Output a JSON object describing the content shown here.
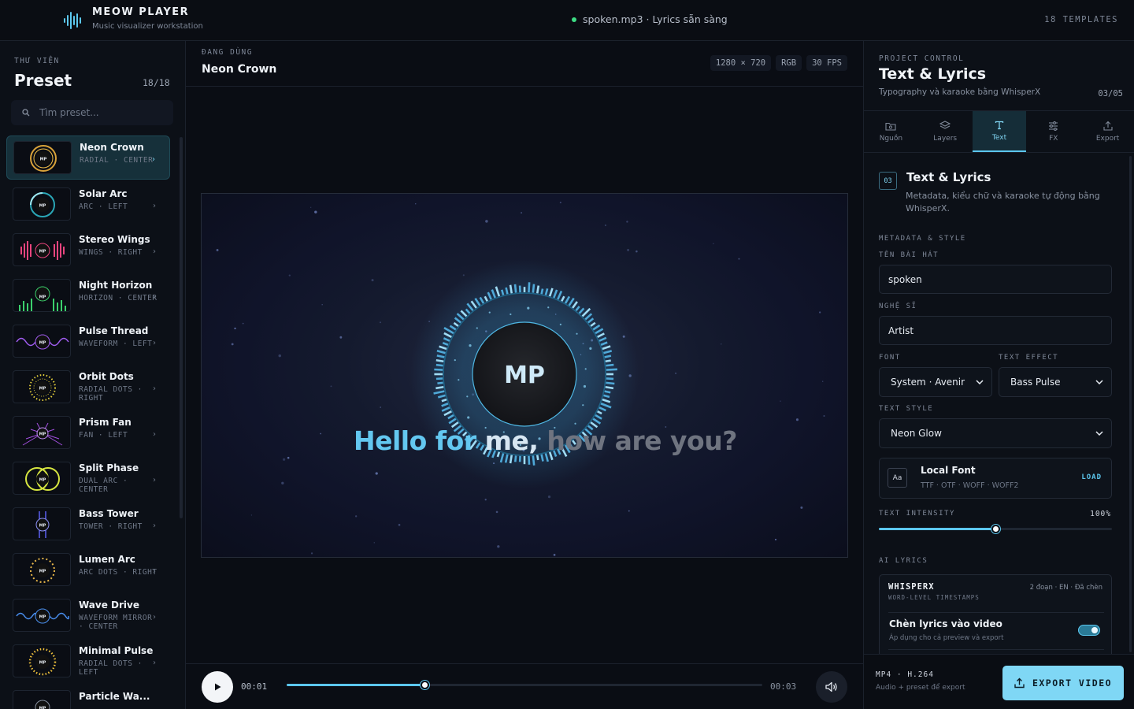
{
  "topbar": {
    "app_title": "MEOW PLAYER",
    "app_subtitle": "Music visualizer workstation",
    "status_text": "spoken.mp3 · Lyrics sẵn sàng",
    "templates": "18 TEMPLATES",
    "status_color": "#3ddc84"
  },
  "sidebar": {
    "caption": "THƯ VIỆN",
    "title": "Preset",
    "count": "18/18",
    "search_placeholder": "Tìm preset...",
    "items": [
      {
        "name": "Neon Crown",
        "tags": "RADIAL · CENTER",
        "active": true,
        "thumb": "neon-crown-thumb"
      },
      {
        "name": "Solar Arc",
        "tags": "ARC · LEFT",
        "thumb": "solar-arc-thumb"
      },
      {
        "name": "Stereo Wings",
        "tags": "WINGS · RIGHT",
        "thumb": "stereo-wings-thumb"
      },
      {
        "name": "Night Horizon",
        "tags": "HORIZON · CENTER",
        "thumb": "night-horizon-thumb"
      },
      {
        "name": "Pulse Thread",
        "tags": "WAVEFORM · LEFT",
        "thumb": "pulse-thread-thumb"
      },
      {
        "name": "Orbit Dots",
        "tags": "RADIAL DOTS · RIGHT",
        "thumb": "orbit-dots-thumb"
      },
      {
        "name": "Prism Fan",
        "tags": "FAN · LEFT",
        "thumb": "prism-fan-thumb"
      },
      {
        "name": "Split Phase",
        "tags": "DUAL ARC · CENTER",
        "thumb": "split-phase-thumb"
      },
      {
        "name": "Bass Tower",
        "tags": "TOWER · RIGHT",
        "thumb": "bass-tower-thumb"
      },
      {
        "name": "Lumen Arc",
        "tags": "ARC DOTS · RIGHT",
        "thumb": "lumen-arc-thumb"
      },
      {
        "name": "Wave Drive",
        "tags": "WAVEFORM MIRROR · CENTER",
        "thumb": "wave-drive-thumb"
      },
      {
        "name": "Minimal Pulse",
        "tags": "RADIAL DOTS · LEFT",
        "thumb": "minimal-pulse-thumb"
      },
      {
        "name": "Particle Wa...",
        "tags": "",
        "thumb": "particle-thumb"
      }
    ]
  },
  "center": {
    "caption": "ĐANG DÙNG",
    "title": "Neon Crown",
    "chips": [
      "1280 × 720",
      "RGB",
      "30 FPS"
    ],
    "logo_text": "MP",
    "lyrics": [
      {
        "text": "Hello",
        "state": "on"
      },
      {
        "text": "for",
        "state": "on"
      },
      {
        "text": "me,",
        "state": "mid"
      },
      {
        "text": "how",
        "state": "off"
      },
      {
        "text": "are",
        "state": "off"
      },
      {
        "text": "you?",
        "state": "off"
      }
    ],
    "accent": "#63c7f0"
  },
  "player": {
    "current_time": "00:01",
    "end_time": "00:03",
    "progress": 0.29
  },
  "right": {
    "caption": "PROJECT CONTROL",
    "title": "Text & Lyrics",
    "subtitle": "Typography và karaoke bằng WhisperX",
    "step": "03/05",
    "tabs": [
      {
        "label": "Nguồn",
        "icon": "folder-icon"
      },
      {
        "label": "Layers",
        "icon": "layers-icon"
      },
      {
        "label": "Text",
        "icon": "text-icon",
        "active": true
      },
      {
        "label": "FX",
        "icon": "sliders-icon"
      },
      {
        "label": "Export",
        "icon": "upload-icon"
      }
    ],
    "section": {
      "num": "03",
      "title": "Text & Lyrics",
      "desc": "Metadata, kiểu chữ và karaoke tự động bằng WhisperX."
    },
    "metadata_caption": "METADATA & STYLE",
    "song_label": "TÊN BÀI HÁT",
    "song_value": "spoken",
    "artist_label": "NGHỆ SĨ",
    "artist_value": "Artist",
    "font_label": "FONT",
    "font_value": "System · Avenir",
    "effect_label": "TEXT EFFECT",
    "effect_value": "Bass Pulse",
    "style_label": "TEXT STYLE",
    "style_value": "Neon Glow",
    "local_font": {
      "badge": "Aa",
      "title": "Local Font",
      "formats": "TTF · OTF · WOFF · WOFF2",
      "action": "LOAD"
    },
    "intensity_label": "TEXT INTENSITY",
    "intensity_value": "100%",
    "intensity_level": 0.5,
    "ai_caption": "AI LYRICS",
    "ai": {
      "name": "WHISPERX",
      "note": "WORD-LEVEL TIMESTAMPS",
      "meta": "2 đoạn · EN · Đã chèn",
      "insert_title": "Chèn lyrics vào video",
      "insert_sub": "Áp dụng cho cả preview và export",
      "insert_on": true
    },
    "footer": {
      "format": "MP4 · H.264",
      "desc": "Audio + preset để export",
      "export_label": "EXPORT VIDEO"
    }
  }
}
